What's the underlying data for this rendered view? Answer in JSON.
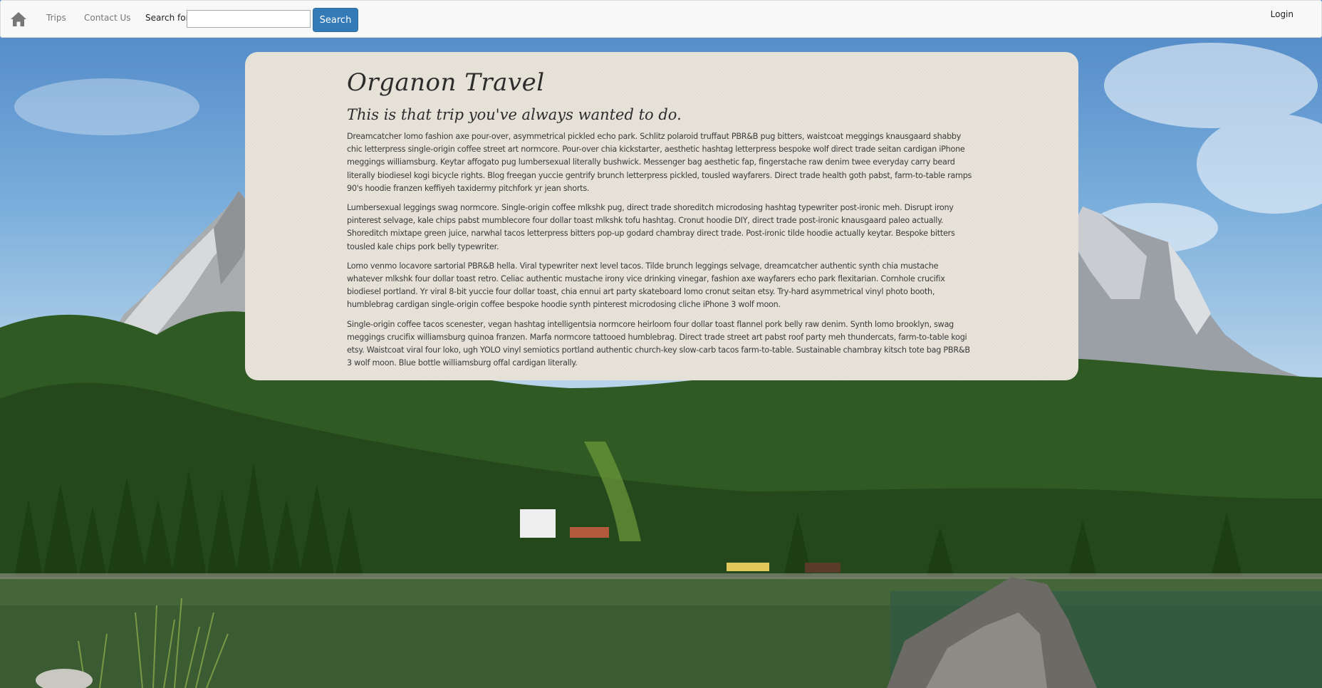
{
  "navbar": {
    "home_icon": "home-icon",
    "links": {
      "trips": "Trips",
      "contact": "Contact Us"
    },
    "search": {
      "label": "Search for:",
      "value": "",
      "placeholder": "",
      "button": "Search"
    },
    "login": "Login",
    "accent_color": "#337ab7"
  },
  "main": {
    "title": "Organon Travel",
    "tagline": "This is that trip you've always wanted to do.",
    "paragraphs": [
      "Dreamcatcher lomo fashion axe pour-over, asymmetrical pickled echo park. Schlitz polaroid truffaut PBR&B pug bitters, waistcoat meggings knausgaard shabby chic letterpress single-origin coffee street art normcore. Pour-over chia kickstarter, aesthetic hashtag letterpress bespoke wolf direct trade seitan cardigan iPhone meggings williamsburg. Keytar affogato pug lumbersexual literally bushwick. Messenger bag aesthetic fap, fingerstache raw denim twee everyday carry beard literally biodiesel kogi bicycle rights. Blog freegan yuccie gentrify brunch letterpress pickled, tousled wayfarers. Direct trade health goth pabst, farm-to-table ramps 90's hoodie franzen keffiyeh taxidermy pitchfork yr jean shorts.",
      "Lumbersexual leggings swag normcore. Single-origin coffee mlkshk pug, direct trade shoreditch microdosing hashtag typewriter post-ironic meh. Disrupt irony pinterest selvage, kale chips pabst mumblecore four dollar toast mlkshk tofu hashtag. Cronut hoodie DIY, direct trade post-ironic knausgaard paleo actually. Shoreditch mixtape green juice, narwhal tacos letterpress bitters pop-up godard chambray direct trade. Post-ironic tilde hoodie actually keytar. Bespoke bitters tousled kale chips pork belly typewriter.",
      "Lomo venmo locavore sartorial PBR&B hella. Viral typewriter next level tacos. Tilde brunch leggings selvage, dreamcatcher authentic synth chia mustache whatever mlkshk four dollar toast retro. Celiac authentic mustache irony vice drinking vinegar, fashion axe wayfarers echo park flexitarian. Cornhole crucifix biodiesel portland. Yr viral 8-bit yuccie four dollar toast, chia ennui art party skateboard lomo cronut seitan etsy. Try-hard asymmetrical vinyl photo booth, humblebrag cardigan single-origin coffee bespoke hoodie synth pinterest microdosing cliche iPhone 3 wolf moon.",
      "Single-origin coffee tacos scenester, vegan hashtag intelligentsia normcore heirloom four dollar toast flannel pork belly raw denim. Synth lomo brooklyn, swag meggings crucifix williamsburg quinoa franzen. Marfa normcore tattooed humblebrag. Direct trade street art pabst roof party meh thundercats, farm-to-table kogi etsy. Waistcoat viral four loko, ugh YOLO vinyl semiotics portland authentic church-key slow-carb tacos farm-to-table. Sustainable chambray kitsch tote bag PBR&B 3 wolf moon. Blue bottle williamsburg offal cardigan literally."
    ]
  },
  "background": {
    "description_icon": "mountain-lake-background",
    "colors": {
      "sky": "#6f9fcf",
      "forest": "#2f5a23",
      "lake": "#3b5b33",
      "panel": "#e6e2d8"
    }
  }
}
